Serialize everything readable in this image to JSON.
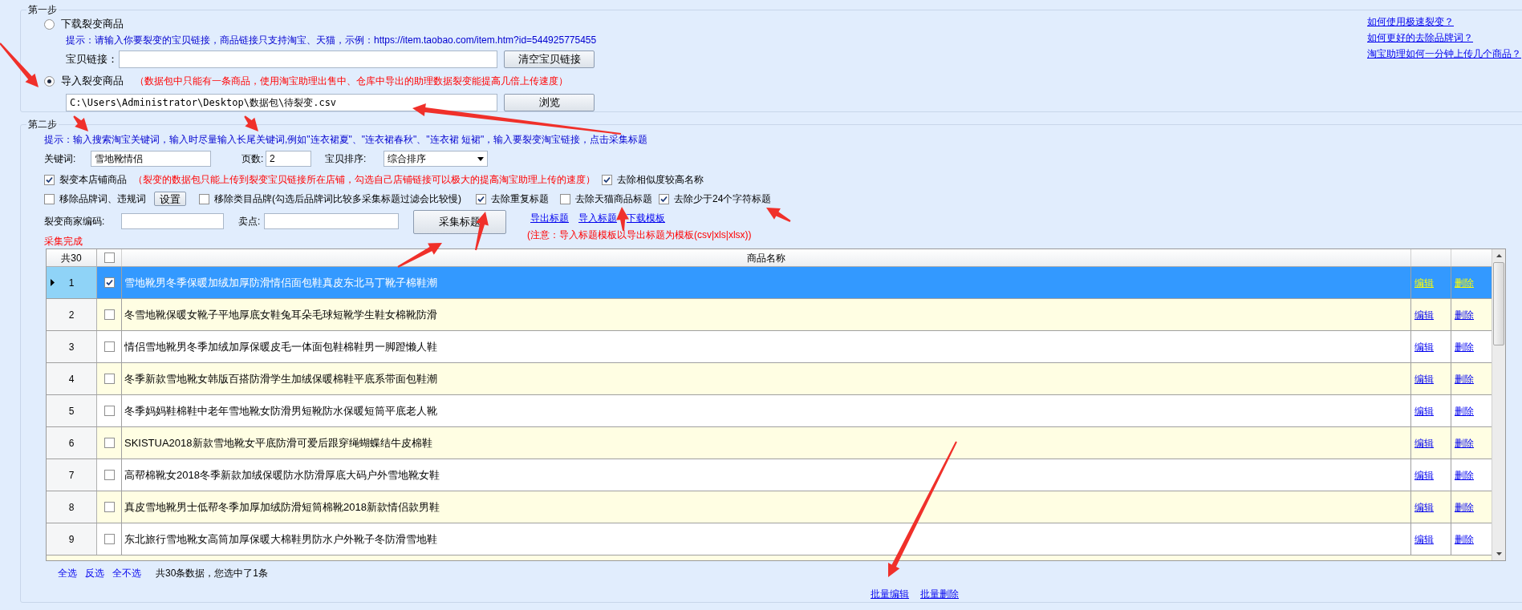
{
  "step1": {
    "legend": "第一步",
    "options": [
      {
        "label": "下载裂变商品",
        "selected": false
      },
      {
        "label": "导入裂变商品",
        "selected": true,
        "note": "（数据包中只能有一条商品，使用淘宝助理出售中、仓库中导出的助理数据裂变能提高几倍上传速度）"
      }
    ],
    "hint": "提示：请输入你要裂变的宝贝链接，商品链接只支持淘宝、天猫，示例：https://item.taobao.com/item.htm?id=544925775455",
    "link_field": {
      "label": "宝贝链接："
    },
    "clear_button": "清空宝贝链接",
    "path_field": {
      "value": "C:\\Users\\Administrator\\Desktop\\数据包\\待裂变.csv"
    },
    "browse_button": "浏览"
  },
  "help_links": [
    "如何使用极速裂变？",
    "如何更好的去除品牌词？",
    "淘宝助理如何一分钟上传几个商品？"
  ],
  "step2": {
    "legend": "第二步",
    "hint": "提示：输入搜索淘宝关键词，输入时尽量输入长尾关键词,例如\"连衣裙夏\"、\"连衣裙春秋\"、\"连衣裙 短裙\"，输入要裂变淘宝链接，点击采集标题",
    "keyword": {
      "label": "关键词:",
      "value": "雪地靴情侣"
    },
    "pages": {
      "label": "页数:",
      "value": "2"
    },
    "sort": {
      "label": "宝贝排序:",
      "value": "综合排序"
    },
    "shop_only": {
      "label": "裂变本店铺商品",
      "checked": true,
      "note": "（裂变的数据包只能上传到裂变宝贝链接所在店铺，勾选自己店铺链接可以极大的提高淘宝助理上传的速度）"
    },
    "remove_similar": {
      "label": "去除相似度较高名称",
      "checked": true
    },
    "remove_brand": {
      "label": "移除品牌词、违规词",
      "checked": false,
      "button": "设置"
    },
    "remove_category_brand": {
      "label": "移除类目品牌(勾选后品牌词比较多采集标题过滤会比较慢)",
      "checked": false
    },
    "remove_duplicate": {
      "label": "去除重复标题",
      "checked": true
    },
    "remove_tmall": {
      "label": "去除天猫商品标题",
      "checked": false
    },
    "remove_short": {
      "label": "去除少于24个字符标题",
      "checked": true
    },
    "merchant_code": {
      "label": "裂变商家编码:"
    },
    "selling_point": {
      "label": "卖点:"
    },
    "collect_button": "采集标题",
    "template_links": [
      "导出标题",
      "导入标题",
      "下载模板"
    ],
    "template_note": "(注意：导入标题模板以导出标题为模板(csv|xls|xlsx))",
    "status": "采集完成"
  },
  "table": {
    "count_label": "共30",
    "select_all_checked": false,
    "columns": [
      "商品名称"
    ],
    "rows": [
      {
        "index": "1",
        "selected": true,
        "checked": true,
        "title": "雪地靴男冬季保暖加绒加厚防滑情侣面包鞋真皮东北马丁靴子棉鞋潮",
        "edit": "编辑",
        "delete": "删除"
      },
      {
        "index": "2",
        "selected": false,
        "checked": false,
        "title": "冬雪地靴保暖女靴子平地厚底女鞋兔耳朵毛球短靴学生鞋女棉靴防滑",
        "edit": "编辑",
        "delete": "删除"
      },
      {
        "index": "3",
        "selected": false,
        "checked": false,
        "title": "情侣雪地靴男冬季加绒加厚保暖皮毛一体面包鞋棉鞋男一脚蹬懒人鞋",
        "edit": "编辑",
        "delete": "删除"
      },
      {
        "index": "4",
        "selected": false,
        "checked": false,
        "title": "冬季新款雪地靴女韩版百搭防滑学生加绒保暖棉鞋平底系带面包鞋潮",
        "edit": "编辑",
        "delete": "删除"
      },
      {
        "index": "5",
        "selected": false,
        "checked": false,
        "title": "冬季妈妈鞋棉鞋中老年雪地靴女防滑男短靴防水保暖短筒平底老人靴",
        "edit": "编辑",
        "delete": "删除"
      },
      {
        "index": "6",
        "selected": false,
        "checked": false,
        "title": "SKISTUA2018新款雪地靴女平底防滑可爱后跟穿绳蝴蝶结牛皮棉鞋",
        "edit": "编辑",
        "delete": "删除"
      },
      {
        "index": "7",
        "selected": false,
        "checked": false,
        "title": "高帮棉靴女2018冬季新款加绒保暖防水防滑厚底大码户外雪地靴女鞋",
        "edit": "编辑",
        "delete": "删除"
      },
      {
        "index": "8",
        "selected": false,
        "checked": false,
        "title": "真皮雪地靴男士低帮冬季加厚加绒防滑短筒棉靴2018新款情侣款男鞋",
        "edit": "编辑",
        "delete": "删除"
      },
      {
        "index": "9",
        "selected": false,
        "checked": false,
        "title": "东北旅行雪地靴女高筒加厚保暖大棉鞋男防水户外靴子冬防滑雪地鞋",
        "edit": "编辑",
        "delete": "删除"
      }
    ]
  },
  "footer": {
    "links": [
      "全选",
      "反选",
      "全不选"
    ],
    "summary": "共30条数据，您选中了1条"
  },
  "bulk_links": [
    "批量编辑",
    "批量删除"
  ]
}
